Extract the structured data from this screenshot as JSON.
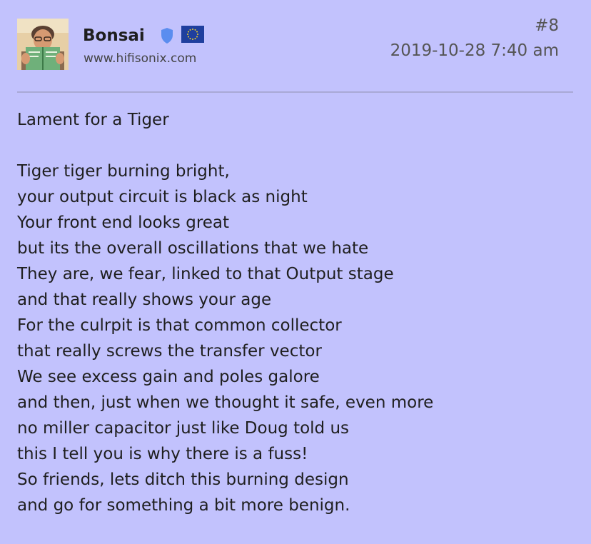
{
  "post": {
    "author": {
      "username": "Bonsai",
      "website": "www.hifisonix.com",
      "avatar_icon": "user-avatar",
      "badge_icon": "shield-icon",
      "flag_icon": "eu-flag-icon"
    },
    "number": "#8",
    "timestamp": "2019-10-28 7:40 am",
    "title": "Lament for a Tiger",
    "lines": [
      "Tiger tiger burning bright,",
      "your output circuit is black as night",
      "Your front end looks great",
      "but its the overall oscillations that we hate",
      "They are, we fear, linked to that Output stage",
      "and that really shows your age",
      "For the culrpit is that common collector",
      "that really screws the transfer vector",
      "We see excess gain and poles galore",
      "and then, just when we thought it safe, even more",
      "no miller capacitor just like Doug told us",
      "this I tell you is why there is a fuss!",
      "So friends, lets ditch this burning design",
      "and go for something a bit more benign."
    ]
  },
  "colors": {
    "background": "#c2c2fd",
    "divider": "#a9a9d6",
    "badge": "#5b8def",
    "flag": "#1f3f9e",
    "flag_stars": "#f5d327"
  }
}
